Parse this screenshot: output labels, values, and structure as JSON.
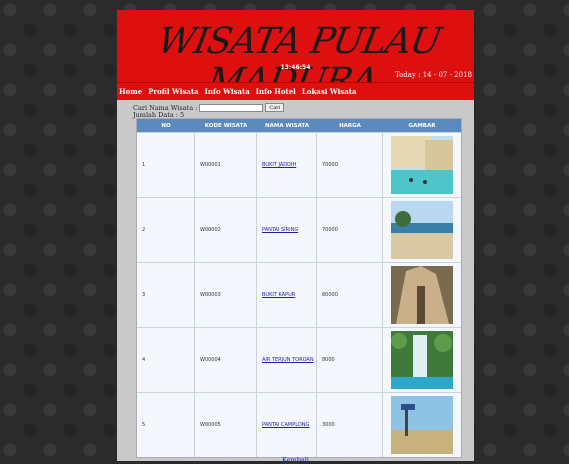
{
  "header": {
    "logo_text": "WISATA PULAU MADURA",
    "clock": "13:46:54",
    "today": "Today : 14 - 07 - 2018"
  },
  "nav": {
    "items": [
      {
        "label": "Home"
      },
      {
        "label": "Profil Wisata"
      },
      {
        "label": "Info Wisata"
      },
      {
        "label": "Info Hotel"
      },
      {
        "label": "Lokasi Wisata"
      }
    ]
  },
  "search": {
    "label": "Cari Nama Wisata :",
    "value": "",
    "button_label": "Cari"
  },
  "count_text": "Jumlah Data : 5",
  "table": {
    "headers": [
      "NO",
      "KODE WISATA",
      "NAMA WISATA",
      "HARGA",
      "GAMBAR"
    ],
    "rows": [
      {
        "no": "1",
        "kode": "W00001",
        "nama": "BUKIT JADDIH",
        "harga": "70000"
      },
      {
        "no": "2",
        "kode": "W00002",
        "nama": "PANTAI SIRING",
        "harga": "70000"
      },
      {
        "no": "3",
        "kode": "W00003",
        "nama": "BUKIT KAPUR",
        "harga": "80000"
      },
      {
        "no": "4",
        "kode": "W00004",
        "nama": "AIR TERJUN TOROAN",
        "harga": "8000"
      },
      {
        "no": "5",
        "kode": "W00005",
        "nama": "PANTAI CAMPLONG",
        "harga": "3000"
      }
    ]
  },
  "footer": {
    "back_label": "Kembali"
  },
  "colors": {
    "banner": "#dd0f0f",
    "table_header": "#5b8abf"
  }
}
